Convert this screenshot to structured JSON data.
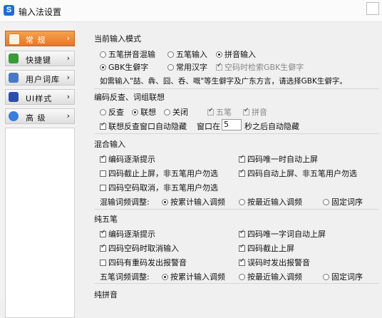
{
  "window": {
    "title": "输入法设置",
    "app_icon": "S"
  },
  "sidebar": {
    "items": [
      {
        "label": "常  规",
        "icon": "settings-icon",
        "active": true
      },
      {
        "label": "快捷键",
        "icon": "keyboard-icon",
        "active": false
      },
      {
        "label": "用户词库",
        "icon": "book-icon",
        "active": false
      },
      {
        "label": "UI样式",
        "icon": "brush-icon",
        "active": false
      },
      {
        "label": "高  级",
        "icon": "gear-icon",
        "active": false
      }
    ]
  },
  "section1": {
    "title": "当前输入模式",
    "modes": [
      "五笔拼音混输",
      "五笔输入",
      "拼音输入"
    ],
    "charsets": [
      "GBK生僻字",
      "常用汉字"
    ],
    "empty_code_option": "空码时检索GBK生僻字",
    "hint": "如需输入\"喆、犇、囧、呑、嘅\"等生僻字及广东方言，请选择GBK生僻字。"
  },
  "section2": {
    "title": "编码反查、词组联想",
    "modes": [
      "反查",
      "联想",
      "关闭"
    ],
    "wubi": "五笔",
    "pinyin": "拼音",
    "autohide_label": "联想反查窗口自动隐藏",
    "window_in": "窗口在",
    "seconds": "5",
    "after_text": "秒之后自动隐藏"
  },
  "section3": {
    "title": "混合输入",
    "options": [
      "编码逐渐提示",
      "四码唯一时自动上屏",
      "四码截止上屏，非五笔用户勿选",
      "四码自动上屏、非五笔用户勿选",
      "四码空码取消，非五笔用户勿选"
    ],
    "freq_label": "混输词频调整:",
    "freq_options": [
      "按累计输入调频",
      "按最近输入调频",
      "固定词序"
    ]
  },
  "section4": {
    "title": "纯五笔",
    "options": [
      "编码逐渐提示",
      "四码唯一字词自动上屏",
      "四码空码时取消输入",
      "四码截止上屏",
      "四码有重码发出报警音",
      "误码时发出报警音"
    ],
    "freq_label": "五笔词频调整:",
    "freq_options": [
      "按累计输入调频",
      "按最近输入调频",
      "固定词序"
    ]
  },
  "section5": {
    "title": "纯拼音"
  }
}
